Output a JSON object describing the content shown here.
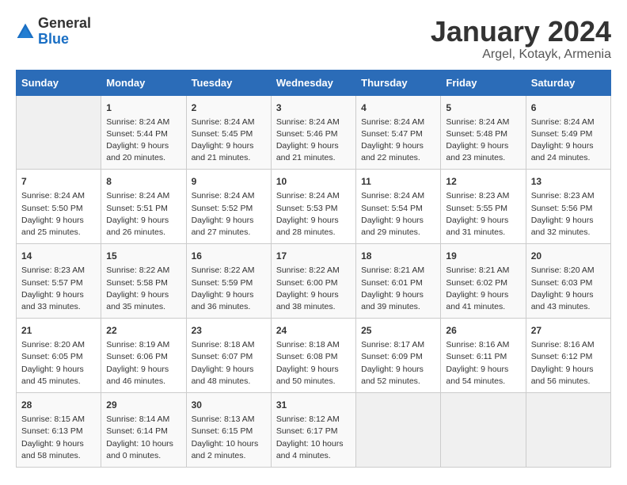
{
  "header": {
    "logo_general": "General",
    "logo_blue": "Blue",
    "month": "January 2024",
    "location": "Argel, Kotayk, Armenia"
  },
  "weekdays": [
    "Sunday",
    "Monday",
    "Tuesday",
    "Wednesday",
    "Thursday",
    "Friday",
    "Saturday"
  ],
  "weeks": [
    [
      {
        "day": "",
        "content": ""
      },
      {
        "day": "1",
        "content": "Sunrise: 8:24 AM\nSunset: 5:44 PM\nDaylight: 9 hours\nand 20 minutes."
      },
      {
        "day": "2",
        "content": "Sunrise: 8:24 AM\nSunset: 5:45 PM\nDaylight: 9 hours\nand 21 minutes."
      },
      {
        "day": "3",
        "content": "Sunrise: 8:24 AM\nSunset: 5:46 PM\nDaylight: 9 hours\nand 21 minutes."
      },
      {
        "day": "4",
        "content": "Sunrise: 8:24 AM\nSunset: 5:47 PM\nDaylight: 9 hours\nand 22 minutes."
      },
      {
        "day": "5",
        "content": "Sunrise: 8:24 AM\nSunset: 5:48 PM\nDaylight: 9 hours\nand 23 minutes."
      },
      {
        "day": "6",
        "content": "Sunrise: 8:24 AM\nSunset: 5:49 PM\nDaylight: 9 hours\nand 24 minutes."
      }
    ],
    [
      {
        "day": "7",
        "content": "Sunrise: 8:24 AM\nSunset: 5:50 PM\nDaylight: 9 hours\nand 25 minutes."
      },
      {
        "day": "8",
        "content": "Sunrise: 8:24 AM\nSunset: 5:51 PM\nDaylight: 9 hours\nand 26 minutes."
      },
      {
        "day": "9",
        "content": "Sunrise: 8:24 AM\nSunset: 5:52 PM\nDaylight: 9 hours\nand 27 minutes."
      },
      {
        "day": "10",
        "content": "Sunrise: 8:24 AM\nSunset: 5:53 PM\nDaylight: 9 hours\nand 28 minutes."
      },
      {
        "day": "11",
        "content": "Sunrise: 8:24 AM\nSunset: 5:54 PM\nDaylight: 9 hours\nand 29 minutes."
      },
      {
        "day": "12",
        "content": "Sunrise: 8:23 AM\nSunset: 5:55 PM\nDaylight: 9 hours\nand 31 minutes."
      },
      {
        "day": "13",
        "content": "Sunrise: 8:23 AM\nSunset: 5:56 PM\nDaylight: 9 hours\nand 32 minutes."
      }
    ],
    [
      {
        "day": "14",
        "content": "Sunrise: 8:23 AM\nSunset: 5:57 PM\nDaylight: 9 hours\nand 33 minutes."
      },
      {
        "day": "15",
        "content": "Sunrise: 8:22 AM\nSunset: 5:58 PM\nDaylight: 9 hours\nand 35 minutes."
      },
      {
        "day": "16",
        "content": "Sunrise: 8:22 AM\nSunset: 5:59 PM\nDaylight: 9 hours\nand 36 minutes."
      },
      {
        "day": "17",
        "content": "Sunrise: 8:22 AM\nSunset: 6:00 PM\nDaylight: 9 hours\nand 38 minutes."
      },
      {
        "day": "18",
        "content": "Sunrise: 8:21 AM\nSunset: 6:01 PM\nDaylight: 9 hours\nand 39 minutes."
      },
      {
        "day": "19",
        "content": "Sunrise: 8:21 AM\nSunset: 6:02 PM\nDaylight: 9 hours\nand 41 minutes."
      },
      {
        "day": "20",
        "content": "Sunrise: 8:20 AM\nSunset: 6:03 PM\nDaylight: 9 hours\nand 43 minutes."
      }
    ],
    [
      {
        "day": "21",
        "content": "Sunrise: 8:20 AM\nSunset: 6:05 PM\nDaylight: 9 hours\nand 45 minutes."
      },
      {
        "day": "22",
        "content": "Sunrise: 8:19 AM\nSunset: 6:06 PM\nDaylight: 9 hours\nand 46 minutes."
      },
      {
        "day": "23",
        "content": "Sunrise: 8:18 AM\nSunset: 6:07 PM\nDaylight: 9 hours\nand 48 minutes."
      },
      {
        "day": "24",
        "content": "Sunrise: 8:18 AM\nSunset: 6:08 PM\nDaylight: 9 hours\nand 50 minutes."
      },
      {
        "day": "25",
        "content": "Sunrise: 8:17 AM\nSunset: 6:09 PM\nDaylight: 9 hours\nand 52 minutes."
      },
      {
        "day": "26",
        "content": "Sunrise: 8:16 AM\nSunset: 6:11 PM\nDaylight: 9 hours\nand 54 minutes."
      },
      {
        "day": "27",
        "content": "Sunrise: 8:16 AM\nSunset: 6:12 PM\nDaylight: 9 hours\nand 56 minutes."
      }
    ],
    [
      {
        "day": "28",
        "content": "Sunrise: 8:15 AM\nSunset: 6:13 PM\nDaylight: 9 hours\nand 58 minutes."
      },
      {
        "day": "29",
        "content": "Sunrise: 8:14 AM\nSunset: 6:14 PM\nDaylight: 10 hours\nand 0 minutes."
      },
      {
        "day": "30",
        "content": "Sunrise: 8:13 AM\nSunset: 6:15 PM\nDaylight: 10 hours\nand 2 minutes."
      },
      {
        "day": "31",
        "content": "Sunrise: 8:12 AM\nSunset: 6:17 PM\nDaylight: 10 hours\nand 4 minutes."
      },
      {
        "day": "",
        "content": ""
      },
      {
        "day": "",
        "content": ""
      },
      {
        "day": "",
        "content": ""
      }
    ]
  ]
}
